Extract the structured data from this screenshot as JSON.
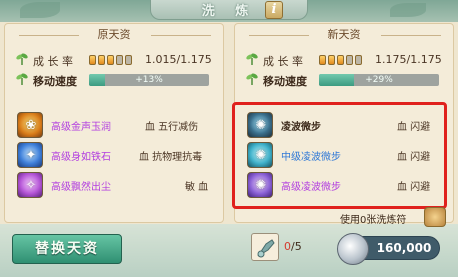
{
  "window": {
    "title": "洗 炼",
    "info_icon": "info-icon",
    "info_label": "i"
  },
  "left_panel": {
    "header": "原天资",
    "growth": {
      "label": "成 长 率",
      "pips_filled": 3,
      "pips_total": 5,
      "value": "1.015/1.175"
    },
    "move_speed": {
      "label": "移动速度",
      "text": "+13%",
      "fill_percent": 13
    },
    "skills": [
      {
        "name": "高级金声玉润",
        "type": "血 五行减伤",
        "color": "#b23ee0",
        "icon": "gold-skill-icon"
      },
      {
        "name": "高级身如铁石",
        "type": "血 抗物理抗毒",
        "color": "#b23ee0",
        "icon": "blue-skill-icon"
      },
      {
        "name": "高级飘然出尘",
        "type": "敏 血",
        "color": "#b23ee0",
        "icon": "purple-skill-icon"
      }
    ]
  },
  "right_panel": {
    "header": "新天资",
    "growth": {
      "label": "成 长 率",
      "pips_filled": 3,
      "pips_total": 5,
      "value": "1.175/1.175"
    },
    "move_speed": {
      "label": "移动速度",
      "text": "+29%",
      "fill_percent": 29
    },
    "skills": [
      {
        "name": "凌波微步",
        "type": "血 闪避",
        "color": "#3e2b1c",
        "icon": "dark-skill-icon"
      },
      {
        "name": "中级凌波微步",
        "type": "血 闪避",
        "color": "#2f78d6",
        "icon": "cyan-skill-icon"
      },
      {
        "name": "高级凌波微步",
        "type": "血 闪避",
        "color": "#b23ee0",
        "icon": "violet-skill-icon"
      }
    ]
  },
  "footer": {
    "use_text": "使用0张洗炼符",
    "replace_button": "替换天资",
    "stone_current": "0",
    "stone_max": "/5",
    "money": "160,000"
  },
  "colors": {
    "highlight": "#e0211d",
    "accent_green": "#3c9b81"
  }
}
